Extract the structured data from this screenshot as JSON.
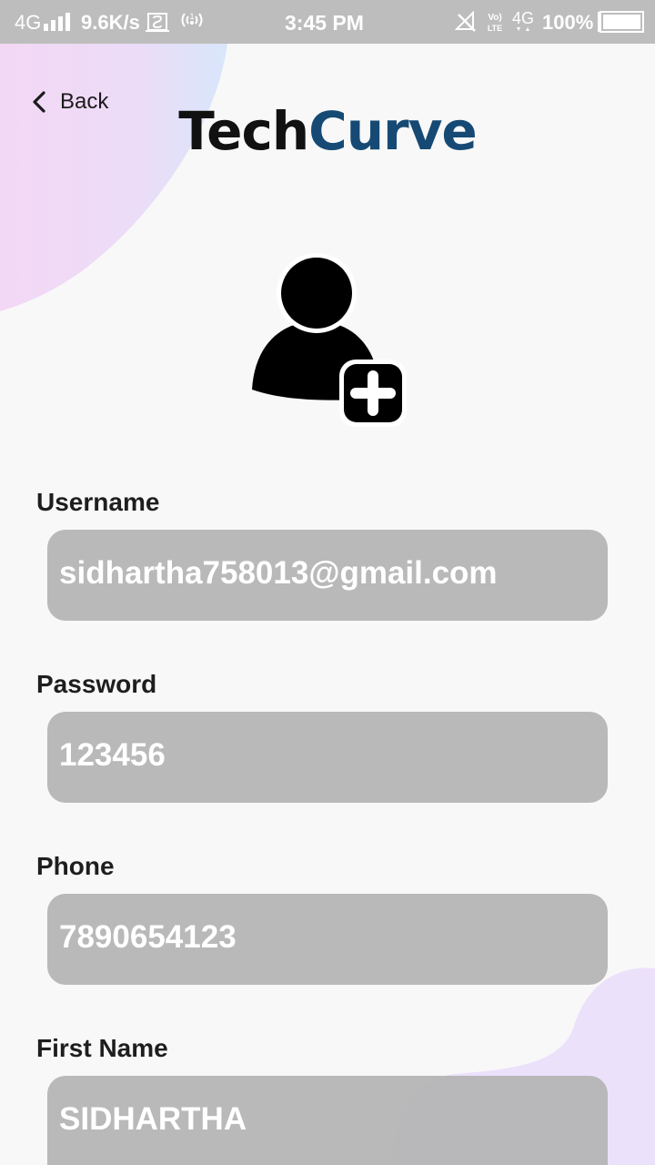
{
  "status_bar": {
    "network_type": "4G",
    "speed": "9.6K/s",
    "time": "3:45 PM",
    "battery_percent": "100%",
    "icons": [
      "signal-icon",
      "screenshot-icon",
      "hotspot-icon",
      "mute-icon",
      "volte-icon",
      "network-4g-icon",
      "battery-icon"
    ]
  },
  "header": {
    "back_label": "Back",
    "logo_part1": "Tech",
    "logo_part2": "Curve"
  },
  "colors": {
    "logo_accent": "#164a74",
    "input_bg": "#b8b8b8",
    "blob_top": "#f0d8f6",
    "blob_bottom": "#ece0fb"
  },
  "form": {
    "fields": [
      {
        "label": "Username",
        "value": "sidhartha758013@gmail.com"
      },
      {
        "label": "Password",
        "value": "123456"
      },
      {
        "label": "Phone",
        "value": "7890654123"
      },
      {
        "label": "First Name",
        "value": "SIDHARTHA"
      }
    ]
  }
}
